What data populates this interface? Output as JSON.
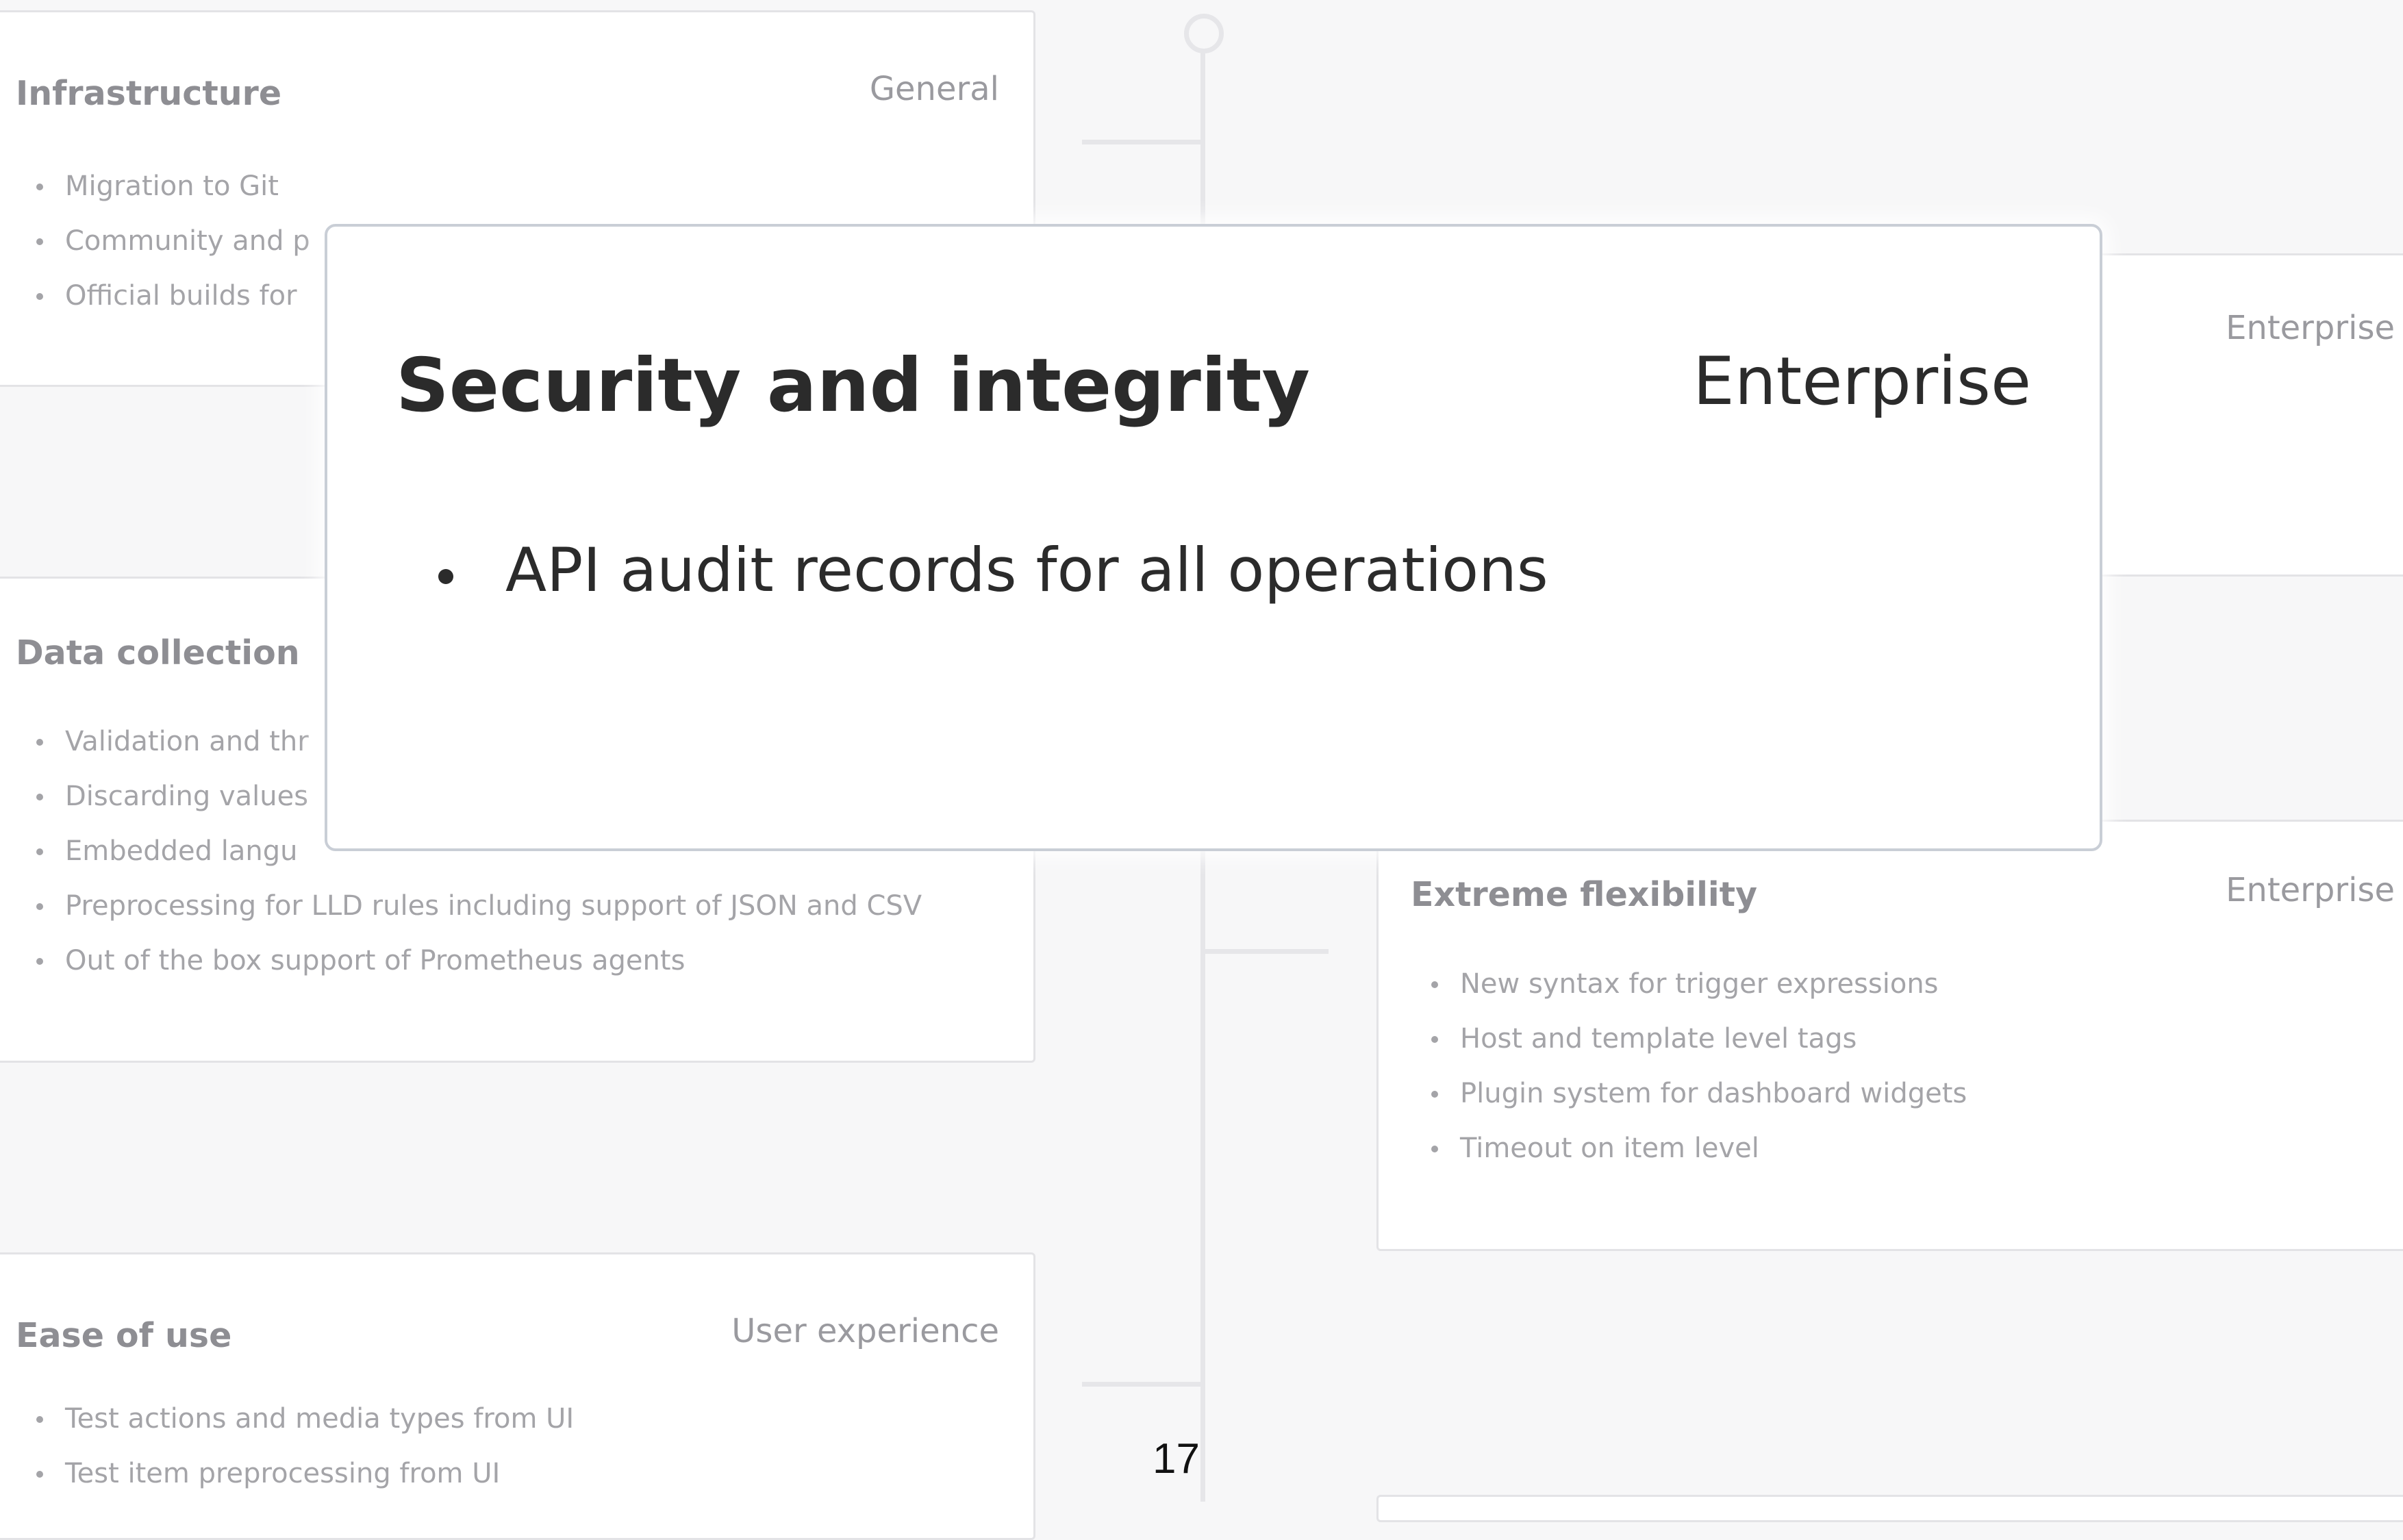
{
  "cards": {
    "infrastructure": {
      "title": "Infrastructure",
      "tag": "General",
      "items": [
        "Migration to Git",
        "Community and p",
        "Official builds for"
      ]
    },
    "data_collection": {
      "title": "Data collection",
      "items": [
        "Validation and thr",
        "Discarding values",
        "Embedded langu",
        "Preprocessing for LLD rules including support of JSON and CSV",
        "Out of the box support of Prometheus agents"
      ]
    },
    "ease_of_use": {
      "title": "Ease of use",
      "tag": "User experience",
      "items": [
        "Test actions and media types from UI",
        "Test item preprocessing from UI"
      ]
    },
    "enterprise_top": {
      "tag": "Enterprise"
    },
    "extreme_flexibility": {
      "title": "Extreme flexibility",
      "tag": "Enterprise",
      "items": [
        "New syntax for trigger expressions",
        "Host and template level tags",
        "Plugin system for dashboard widgets",
        "Timeout on item level"
      ]
    }
  },
  "modal": {
    "title": "Security and integrity",
    "tag": "Enterprise",
    "items": [
      "API audit records for all operations"
    ]
  },
  "page_number": "17"
}
